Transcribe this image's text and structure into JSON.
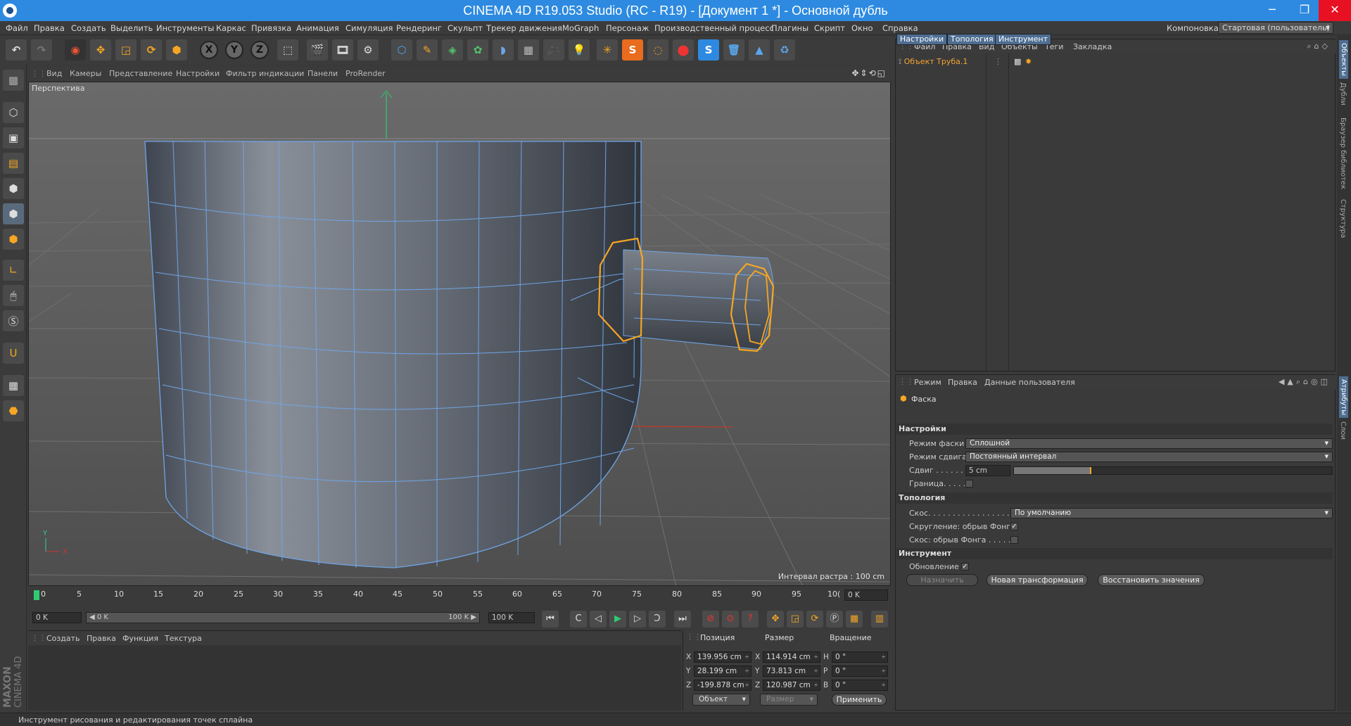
{
  "window": {
    "title": "CINEMA 4D R19.053 Studio (RC - R19) - [Документ 1 *] - Основной дубль",
    "minimize": "─",
    "maximize": "❐",
    "close": "✕"
  },
  "menubar": {
    "items": [
      "Файл",
      "Правка",
      "Создать",
      "Выделить",
      "Инструменты",
      "Каркас",
      "Привязка",
      "Анимация",
      "Симуляция",
      "Рендеринг",
      "Скульпт",
      "Трекер движения",
      "MoGraph",
      "Персонаж",
      "Производственный процесс",
      "Плагины",
      "Скрипт",
      "Окно",
      "Справка"
    ],
    "layout_label": "Компоновка",
    "layout_value": "Стартовая (пользователь)"
  },
  "toolbar": {
    "axis_x": "X",
    "axis_y": "Y",
    "axis_z": "Z"
  },
  "viewport": {
    "menu": [
      "Вид",
      "Камеры",
      "Представление",
      "Настройки",
      "Фильтр индикации",
      "Панели",
      "ProRender"
    ],
    "camera_label": "Перспектива",
    "grid_info": "Интервал растра : 100 cm",
    "axis_y": "Y",
    "axis_x": "X"
  },
  "timeline": {
    "ticks": [
      "0",
      "5",
      "10",
      "15",
      "20",
      "25",
      "30",
      "35",
      "40",
      "45",
      "50",
      "55",
      "60",
      "65",
      "70",
      "75",
      "80",
      "85",
      "90",
      "95",
      "10("
    ],
    "current_frame": "0 K",
    "start_field": "0 K",
    "range_start": "◀ 0 K",
    "range_end": "100 K ▶",
    "end_field": "100 K"
  },
  "material_manager": {
    "menu": [
      "Создать",
      "Правка",
      "Функция",
      "Текстура"
    ],
    "logo_maxon": "MAXON",
    "logo_c4d": "CINEMA 4D"
  },
  "coordinates": {
    "headers": {
      "position": "Позиция",
      "size": "Размер",
      "rotation": "Вращение"
    },
    "rows": [
      {
        "axis": "X",
        "pos": "139.956 cm",
        "size_axis": "X",
        "size": "114.914 cm",
        "rot_axis": "H",
        "rot": "0 °"
      },
      {
        "axis": "Y",
        "pos": "28.199 cm",
        "size_axis": "Y",
        "size": "73.813 cm",
        "rot_axis": "P",
        "rot": "0 °"
      },
      {
        "axis": "Z",
        "pos": "-199.878 cm",
        "size_axis": "Z",
        "size": "120.987 cm",
        "rot_axis": "B",
        "rot": "0 °"
      }
    ],
    "mode_select": "Объект",
    "size_select": "Размер",
    "apply": "Применить"
  },
  "status": "Инструмент рисования и редактирования точек сплайна",
  "object_manager": {
    "menu": [
      "Файл",
      "Правка",
      "Вид",
      "Объекты",
      "Теги",
      "Закладка"
    ],
    "objects": [
      {
        "name": "Объект Труба.1"
      }
    ]
  },
  "attribute_manager": {
    "menu": [
      "Режим",
      "Правка",
      "Данные пользователя"
    ],
    "tool_title": "Фаска",
    "tabs": [
      "Настройки",
      "Топология",
      "Инструмент"
    ],
    "sections": {
      "settings": "Настройки",
      "topology": "Топология",
      "tool": "Инструмент"
    },
    "bevel_mode_label": "Режим фаски",
    "bevel_mode_value": "Сплошной",
    "offset_mode_label": "Режим сдвига",
    "offset_mode_value": "Постоянный интервал",
    "offset_label": "Сдвиг . . . . . .",
    "offset_value": "5 cm",
    "offset_slider": 0.06,
    "limit_label": "Граница. . . . .",
    "mitering_label": "Скос. . . . . . . . . . . . . . . . . . .",
    "mitering_value": "По умолчанию",
    "phong_round_label": "Скругление: обрыв Фонга",
    "phong_round_check": "✓",
    "phong_miter_label": "Скос: обрыв Фонга . . . . .",
    "update_label": "Обновление",
    "update_check": "✓",
    "assign_btn": "Назначить",
    "new_transform_btn": "Новая трансформация",
    "reset_btn": "Восстановить значения"
  },
  "side_tabs": [
    "Объекты",
    "Дубли",
    "Браузер библиотек",
    "Структура",
    "Атрибуты",
    "Слои"
  ],
  "colors": {
    "accent": "#2d8ae0",
    "selection": "#f6a623",
    "wire": "#6fa5e6"
  }
}
